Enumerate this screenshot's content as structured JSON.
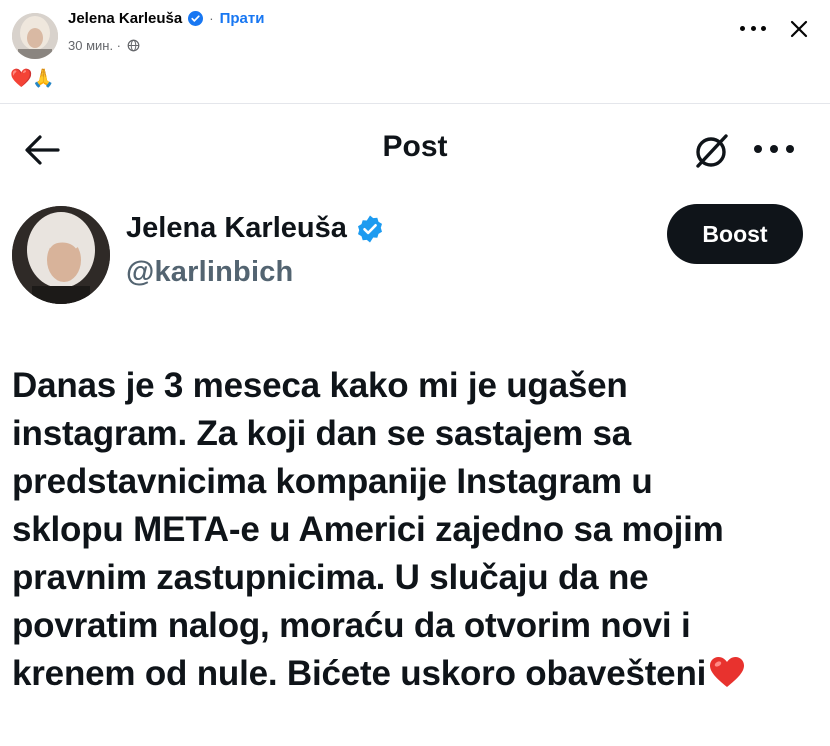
{
  "facebook": {
    "author_name": "Jelena Karleuša",
    "follow_label": "Прати",
    "separator": "·",
    "time_ago": "30 мин. ·",
    "caption_emojis": "❤️🙏",
    "icons": {
      "verified": "verified-badge-icon",
      "audience": "globe-icon",
      "more": "more-dots-icon",
      "close": "close-icon"
    },
    "accent_color": "#1877f2"
  },
  "x_post": {
    "page_title": "Post",
    "author_name": "Jelena Karleuša",
    "handle": "@karlinbich",
    "boost_label": "Boost",
    "icons": {
      "back": "arrow-left-icon",
      "grok": "grok-icon",
      "more": "more-dots-icon",
      "verified": "verified-badge-icon"
    },
    "verified_color": "#1d9bf0",
    "text_lines": [
      "Danas je 3 meseca kako mi je ugašen",
      "instagram. Za koji dan se sastajem sa",
      "predstavnicima kompanije Instagram u",
      "sklopu META-e u Americi zajedno sa mojim",
      "pravnim zastupnicima. U slučaju da ne",
      "povratim nalog, moraću da otvorim novi i",
      "krenem od nule. Bićete uskoro obavešteni"
    ],
    "trailing_emoji": "red-heart-icon"
  }
}
